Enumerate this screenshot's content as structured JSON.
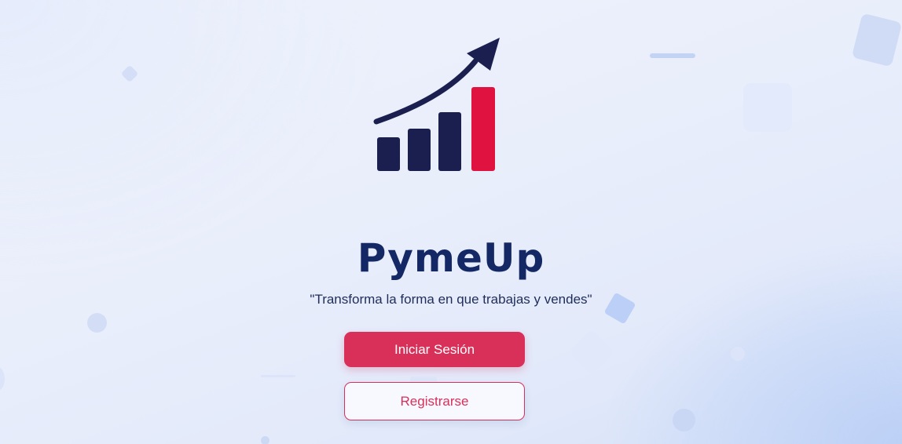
{
  "brand": {
    "name": "PymeUp",
    "tagline": "\"Transforma la forma en que trabajas y vendes\""
  },
  "actions": {
    "login_label": "Iniciar Sesión",
    "register_label": "Registrarse"
  },
  "colors": {
    "primary_navy": "#142865",
    "accent_red": "#d9305a",
    "logo_bar": "#1b1f4f",
    "logo_highlight_bar": "#e0123f"
  },
  "icons": [
    "growth-chart-logo-icon"
  ]
}
